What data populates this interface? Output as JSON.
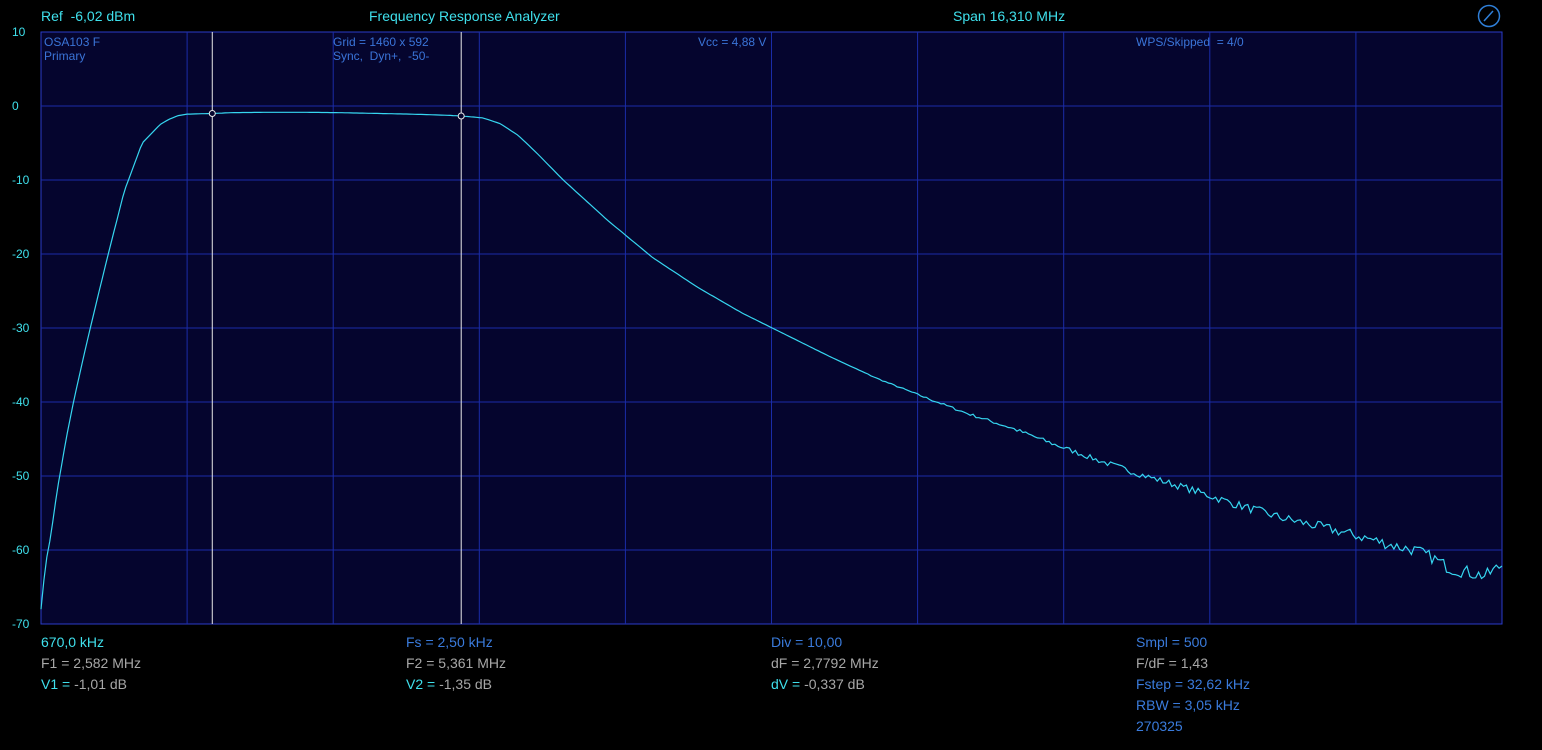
{
  "header": {
    "ref": "Ref  -6,02 dBm",
    "title": "Frequency Response Analyzer",
    "span": "Span 16,310 MHz"
  },
  "overlay": {
    "device": "OSA103 F",
    "mode": "Primary",
    "grid": "Grid = 1460 x 592",
    "sync": "Sync,  Dyn+,  -50-",
    "vcc": "Vcc = 4,88 V",
    "wps": "WPS/Skipped  = 4/0"
  },
  "readouts": {
    "start_freq": "670,0 kHz",
    "f1_label": "F1 = ",
    "f1_value": "2,582 MHz",
    "v1_label": "V1 = ",
    "v1_value": "-1,01 dB",
    "fs": "Fs = 2,50 kHz",
    "f2_label": "F2 = ",
    "f2_value": "5,361 MHz",
    "v2_label": "V2 = ",
    "v2_value": "-1,35 dB",
    "div": "Div = 10,00",
    "df_label": "dF = ",
    "df_value": "2,7792 MHz",
    "dv_label": "dV = ",
    "dv_value": "-0,337 dB",
    "smpl": "Smpl = 500",
    "fdf": "F/dF = 1,43",
    "fstep": "Fstep = 32,62 kHz",
    "rbw": "RBW = 3,05 kHz",
    "code": "270325"
  },
  "colors": {
    "background": "#000000",
    "plot_bg": "#05052e",
    "grid": "#1a2ca8",
    "trace": "#36d6f0",
    "marker": "#e8e8e8",
    "cyan_text": "#3fe0ec",
    "blue_text": "#3a7bdc",
    "gray_text": "#a7a7a7"
  },
  "chart_data": {
    "type": "line",
    "x_unit": "MHz",
    "y_unit": "dB",
    "xlim": [
      0.67,
      16.98
    ],
    "ylim": [
      -70,
      10
    ],
    "y_ticks": [
      10,
      0,
      -10,
      -20,
      -30,
      -40,
      -50,
      -60,
      -70
    ],
    "x_divisions": 10,
    "grid": true,
    "markers": [
      {
        "x": 2.582,
        "y": -1.01
      },
      {
        "x": 5.361,
        "y": -1.35
      }
    ],
    "series": [
      {
        "x": [
          0.67,
          0.72,
          0.78,
          0.85,
          0.95,
          1.05,
          1.2,
          1.4,
          1.6,
          1.8,
          2.0,
          2.1,
          2.2,
          2.3,
          2.45,
          2.582,
          2.8,
          3.2,
          3.6,
          4.0,
          4.4,
          4.8,
          5.2,
          5.361,
          5.6,
          5.8,
          6.0,
          6.2,
          6.5,
          7.0,
          7.5,
          8.0,
          8.5,
          9.0,
          9.5,
          10.0,
          10.5,
          11.0,
          11.5,
          12.0,
          12.5,
          13.0,
          13.5,
          14.0,
          14.5,
          15.0,
          15.5,
          15.8,
          16.0,
          16.2,
          16.4,
          16.6,
          16.8,
          16.98
        ],
        "y": [
          -68.0,
          -62.0,
          -58.0,
          -52.0,
          -45.0,
          -39.0,
          -31.0,
          -21.0,
          -11.5,
          -5.0,
          -2.5,
          -1.8,
          -1.3,
          -1.1,
          -1.05,
          -1.01,
          -0.9,
          -0.85,
          -0.85,
          -0.9,
          -1.0,
          -1.1,
          -1.25,
          -1.35,
          -1.6,
          -2.4,
          -4.0,
          -6.3,
          -10.0,
          -15.5,
          -20.5,
          -24.5,
          -28.0,
          -31.0,
          -34.0,
          -36.8,
          -39.2,
          -41.5,
          -43.5,
          -45.8,
          -48.0,
          -50.0,
          -51.8,
          -53.8,
          -55.6,
          -57.0,
          -58.5,
          -59.5,
          -60.0,
          -61.0,
          -62.5,
          -63.0,
          -63.5,
          -62.0
        ]
      }
    ]
  }
}
